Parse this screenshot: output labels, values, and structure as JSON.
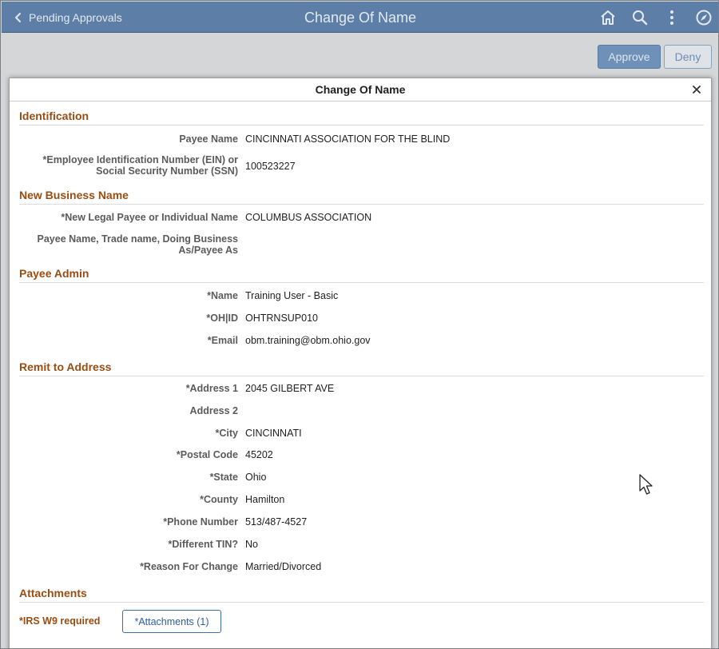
{
  "topbar": {
    "back_label": "Pending Approvals",
    "title": "Change Of Name",
    "icons": [
      "home-icon",
      "search-icon",
      "more-vertical-icon",
      "compass-icon"
    ]
  },
  "actions": {
    "approve_label": "Approve",
    "deny_label": "Deny"
  },
  "modal": {
    "title": "Change Of Name",
    "close_icon": "close-icon"
  },
  "sections": {
    "identification": {
      "title": "Identification",
      "payee_name_label": "Payee Name",
      "payee_name_value": "CINCINNATI ASSOCIATION FOR THE BLIND",
      "ein_label_line1": "*Employee Identification Number (EIN) or",
      "ein_label_line2": "Social Security Number (SSN)",
      "ein_value": "100523227"
    },
    "new_business_name": {
      "title": "New Business Name",
      "legal_name_label": "*New Legal Payee or Individual Name",
      "legal_name_value": "COLUMBUS ASSOCIATION",
      "dba_label_line1": "Payee Name, Trade name, Doing Business",
      "dba_label_line2": "As/Payee As",
      "dba_value": ""
    },
    "payee_admin": {
      "title": "Payee Admin",
      "name_label": "*Name",
      "name_value": "Training User - Basic",
      "ohid_label": "*OH|ID",
      "ohid_value": "OHTRNSUP010",
      "email_label": "*Email",
      "email_value": "obm.training@obm.ohio.gov"
    },
    "remit_address": {
      "title": "Remit to Address",
      "address1_label": "*Address 1",
      "address1_value": "2045 GILBERT AVE",
      "address2_label": "Address 2",
      "address2_value": "",
      "city_label": "*City",
      "city_value": "CINCINNATI",
      "postal_label": "*Postal Code",
      "postal_value": "45202",
      "state_label": "*State",
      "state_value": "Ohio",
      "county_label": "*County",
      "county_value": "Hamilton",
      "phone_label": "*Phone Number",
      "phone_value": "513/487-4527",
      "tin_label": "*Different TIN?",
      "tin_value": "No",
      "reason_label": "*Reason For Change",
      "reason_value": "Married/Divorced"
    },
    "attachments": {
      "title": "Attachments",
      "required_text": "*IRS W9 required",
      "button_label": "*Attachments (1)"
    }
  },
  "colors": {
    "topbar": "#5d7fa7",
    "section_heading": "#9a4d12",
    "link_button": "#2d5f9c"
  }
}
